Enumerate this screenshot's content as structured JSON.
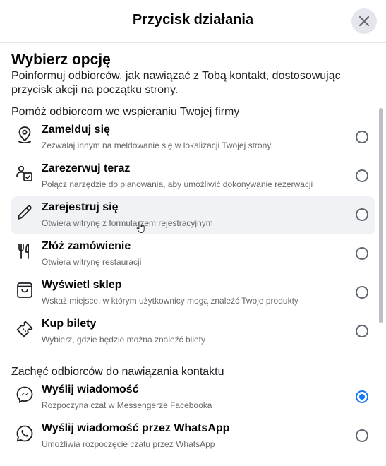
{
  "dialog": {
    "title": "Przycisk działania",
    "close_icon": "close-icon"
  },
  "main": {
    "heading": "Wybierz opcję",
    "description": "Poinformuj odbiorców, jak nawiązać z Tobą kontakt, dostosowując przycisk akcji na początku strony."
  },
  "sections": [
    {
      "title": "Pomóż odbiorcom we wspieraniu Twojej firmy",
      "options": [
        {
          "title": "Zamelduj się",
          "subtitle": "Zezwalaj innym na meldowanie się w lokalizacji Twojej strony.",
          "icon": "location-pin-icon",
          "selected": false
        },
        {
          "title": "Zarezerwuj teraz",
          "subtitle": "Połącz narzędzie do planowania, aby umożliwić dokonywanie rezerwacji",
          "icon": "booking-icon",
          "selected": false
        },
        {
          "title": "Zarejestruj się",
          "subtitle": "Otwiera witrynę z formularzem rejestracyjnym",
          "icon": "pencil-icon",
          "selected": false
        },
        {
          "title": "Złóż zamówienie",
          "subtitle": "Otwiera witrynę restauracji",
          "icon": "fork-knife-icon",
          "selected": false
        },
        {
          "title": "Wyświetl sklep",
          "subtitle": "Wskaż miejsce, w którym użytkownicy mogą znaleźć Twoje produkty",
          "icon": "shop-icon",
          "selected": false
        },
        {
          "title": "Kup bilety",
          "subtitle": "Wybierz, gdzie będzie można znaleźć bilety",
          "icon": "ticket-icon",
          "selected": false
        }
      ]
    },
    {
      "title": "Zachęć odbiorców do nawiązania kontaktu",
      "options": [
        {
          "title": "Wyślij wiadomość",
          "subtitle": "Rozpoczyna czat w Messengerze Facebooka",
          "icon": "messenger-icon",
          "selected": true
        },
        {
          "title": "Wyślij wiadomość przez WhatsApp",
          "subtitle": "Umożliwia rozpoczęcie czatu przez WhatsApp",
          "icon": "whatsapp-icon",
          "selected": false
        }
      ]
    }
  ],
  "colors": {
    "accent": "#1877f2",
    "hover_bg": "#f0f2f5",
    "secondary_text": "#65676b"
  }
}
